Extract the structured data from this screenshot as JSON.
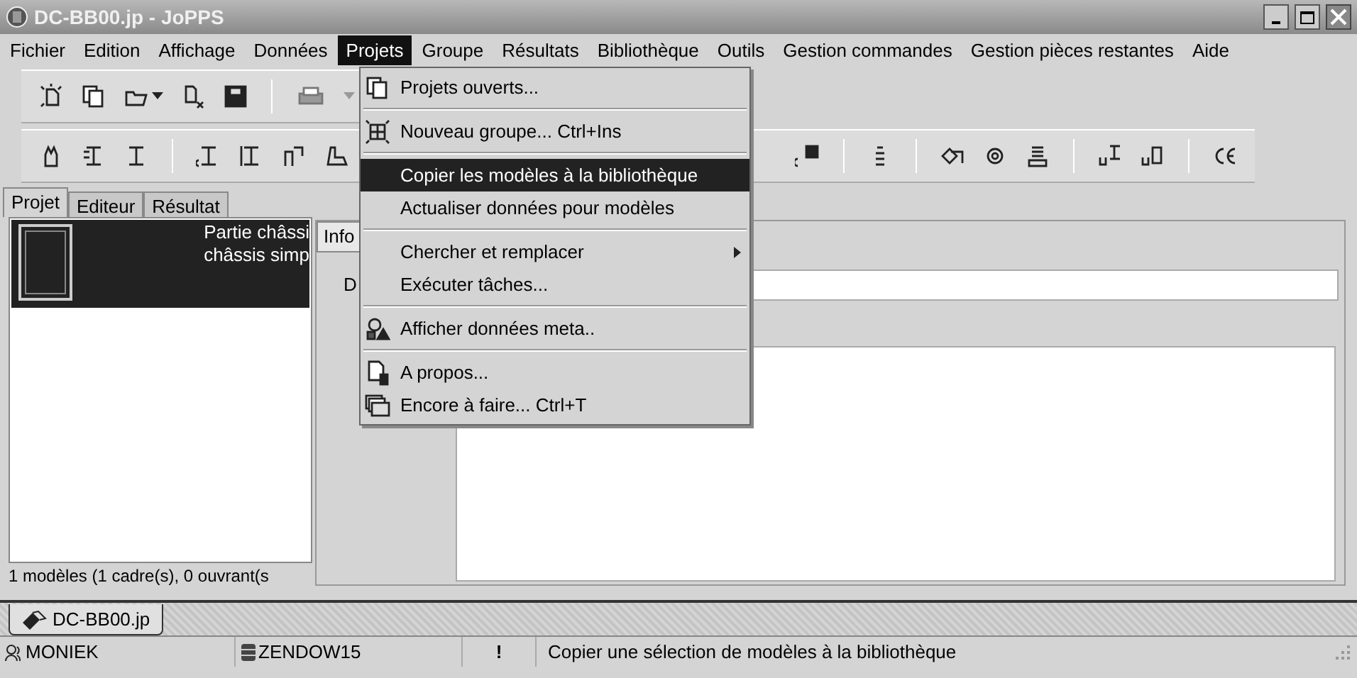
{
  "window": {
    "title": "DC-BB00.jp - JoPPS"
  },
  "menu_bar": [
    {
      "label": "Fichier",
      "selected": false
    },
    {
      "label": "Edition",
      "selected": false
    },
    {
      "label": "Affichage",
      "selected": false
    },
    {
      "label": "Données",
      "selected": false
    },
    {
      "label": "Projets",
      "selected": true
    },
    {
      "label": "Groupe",
      "selected": false
    },
    {
      "label": "Résultats",
      "selected": false
    },
    {
      "label": "Bibliothèque",
      "selected": false
    },
    {
      "label": "Outils",
      "selected": false
    },
    {
      "label": "Gestion commandes",
      "selected": false
    },
    {
      "label": "Gestion pièces restantes",
      "selected": false
    },
    {
      "label": "Aide",
      "selected": false
    }
  ],
  "projets_menu": [
    {
      "kind": "item",
      "label": "Projets ouverts...",
      "selected": false,
      "submenu": false
    },
    {
      "kind": "separator"
    },
    {
      "kind": "item",
      "label": "Nouveau groupe... Ctrl+Ins",
      "selected": false,
      "submenu": false
    },
    {
      "kind": "separator"
    },
    {
      "kind": "item",
      "label": "Copier les modèles à la bibliothèque",
      "selected": true,
      "submenu": false
    },
    {
      "kind": "item",
      "label": "Actualiser données pour modèles",
      "selected": false,
      "submenu": false
    },
    {
      "kind": "separator"
    },
    {
      "kind": "item",
      "label": "Chercher et remplacer",
      "selected": false,
      "submenu": true
    },
    {
      "kind": "item",
      "label": "Exécuter tâches...",
      "selected": false,
      "submenu": false
    },
    {
      "kind": "separator"
    },
    {
      "kind": "item",
      "label": "Afficher données meta..",
      "selected": false,
      "submenu": false
    },
    {
      "kind": "separator"
    },
    {
      "kind": "item",
      "label": "A propos...",
      "selected": false,
      "submenu": false
    },
    {
      "kind": "item",
      "label": "Encore à faire... Ctrl+T",
      "selected": false,
      "submenu": false
    }
  ],
  "panel_tabs": [
    {
      "label": "Projet",
      "selected": true
    },
    {
      "label": "Editeur",
      "selected": false
    },
    {
      "label": "Résultat",
      "selected": false
    }
  ],
  "models": [
    {
      "lines": [
        "Partie châssi",
        "châssis simp"
      ],
      "selected": true
    }
  ],
  "models_summary": "1 modèles (1 cadre(s), 0 ouvrant(s",
  "detail_tabs": [
    {
      "label": "Info",
      "selected": true
    }
  ],
  "detail_fields": [
    {
      "label": "D"
    }
  ],
  "document_tabs": [
    {
      "label": "DC-BB00.jp",
      "selected": true
    }
  ],
  "status_bar": {
    "user": "MONIEK",
    "database": "ZENDOW15",
    "alert": "!",
    "message": "Copier une sélection de modèles à la bibliothèque"
  }
}
